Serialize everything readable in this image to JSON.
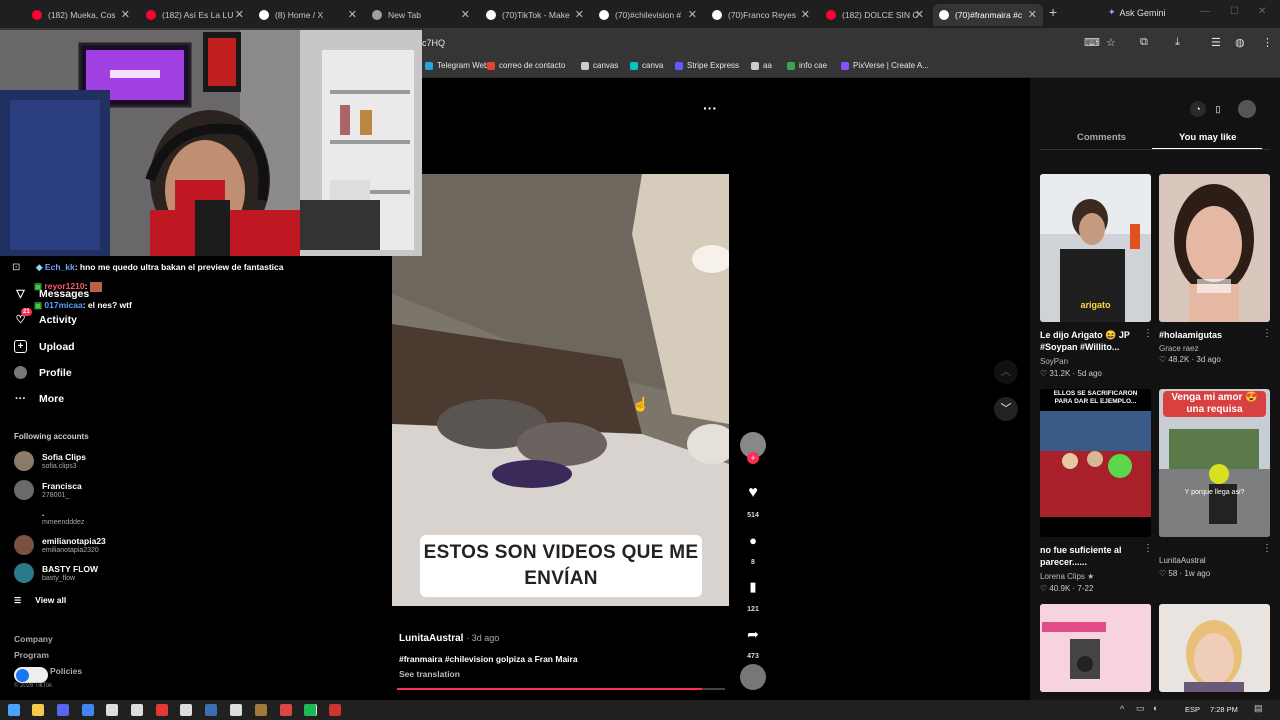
{
  "browser": {
    "tabs": [
      {
        "label": "(182) Mueka, Cos",
        "color": "#ff0033"
      },
      {
        "label": "(182) Así Es La LU",
        "color": "#ff0033"
      },
      {
        "label": "(8) Home / X",
        "color": "#ffffff"
      },
      {
        "label": "New Tab",
        "color": "#9aa0a6"
      },
      {
        "label": "(70)TikTok - Make",
        "color": "#ffffff"
      },
      {
        "label": "(70)#chilevision #",
        "color": "#ffffff"
      },
      {
        "label": "(70)Franco Reyes",
        "color": "#ffffff"
      },
      {
        "label": "(182) DOLCE SIN C",
        "color": "#ff0033"
      },
      {
        "label": "(70)#franmaira #c",
        "color": "#ffffff"
      }
    ],
    "new_tab_symbol": "+",
    "ask_gemini": "Ask Gemini",
    "url_fragment": "c7HQ",
    "bookmarks": [
      {
        "label": "Telegram Web",
        "color": "#2aa3df"
      },
      {
        "label": "correo de contacto",
        "color": "#ea4335"
      },
      {
        "label": "canvas",
        "color": "#cccccc"
      },
      {
        "label": "canva",
        "color": "#00c4cc"
      },
      {
        "label": "Stripe Express",
        "color": "#635bff"
      },
      {
        "label": "aa",
        "color": "#cccccc"
      },
      {
        "label": "info cae",
        "color": "#34a853"
      },
      {
        "label": "PixVerse | Create A...",
        "color": "#8a4fff"
      }
    ]
  },
  "chat": [
    {
      "user": "Ech_kk",
      "message": ": hno me quedo ultra bakan el preview de fantastica"
    },
    {
      "user": "reyor1210",
      "message": ":"
    },
    {
      "user": "017micaa",
      "message": ": el nes? wtf"
    }
  ],
  "nav": {
    "messages": "Messages",
    "activity": "Activity",
    "activity_badge": "21",
    "upload": "Upload",
    "profile": "Profile",
    "more": "More"
  },
  "following": {
    "title": "Following accounts",
    "accounts": [
      {
        "name": "Sofia Clips",
        "handle": "sofia.clips3"
      },
      {
        "name": "Francisca",
        "handle": "27800​1_"
      },
      {
        "name": ".",
        "handle": "mmeendddez"
      },
      {
        "name": "emilianotapia23",
        "handle": "emilianotapia2320"
      },
      {
        "name": "BASTY FLOW",
        "handle": "basty_flow"
      }
    ],
    "view_all": "View all"
  },
  "footer": {
    "company": "Company",
    "program": "Program",
    "policies": "Policies",
    "copyright": "© 2026 TikTok"
  },
  "video": {
    "caption_overlay": "ESTOS SON VIDEOS QUE ME ENVÍAN",
    "author": "LunitaAustral",
    "age": "· 3d ago",
    "description": "#franmaira #chilevision golpiza a Fran Maira",
    "see_translation": "See translation",
    "progress": 0.93,
    "more_symbol": "···",
    "likes": "514",
    "comments": "8",
    "saves": "121",
    "shares": "473"
  },
  "panel": {
    "tab_comments": "Comments",
    "tab_you_may_like": "You may like",
    "cards": [
      {
        "title": "Le dijo Arigato 😆 JP #Soypan #Willito...",
        "author": "SoyPan",
        "stats": "♡ 31.2K · 5d ago",
        "thumb_text": "arigato"
      },
      {
        "title": "#holaamigutas",
        "author": "Grace raez",
        "stats": "♡ 48.2K · 3d ago",
        "thumb_text": ""
      },
      {
        "title": "no fue suficiente al parecer......",
        "author": "Lorena Clips ★",
        "stats": "♡ 40.9K · 7-22",
        "thumb_text": "ELLOS SE SACRIFICARON PARA DAR EL EJEMPLO..."
      },
      {
        "title": "",
        "author": "LunitaAustral",
        "stats": "♡ 58 · 1w ago",
        "thumb_text": "Vengа mi amor 😍 una requisa"
      }
    ],
    "card4_subtitle": "Y porque llega asi?"
  },
  "taskbar": {
    "lang": "ESP",
    "time": "7:28 PM"
  }
}
